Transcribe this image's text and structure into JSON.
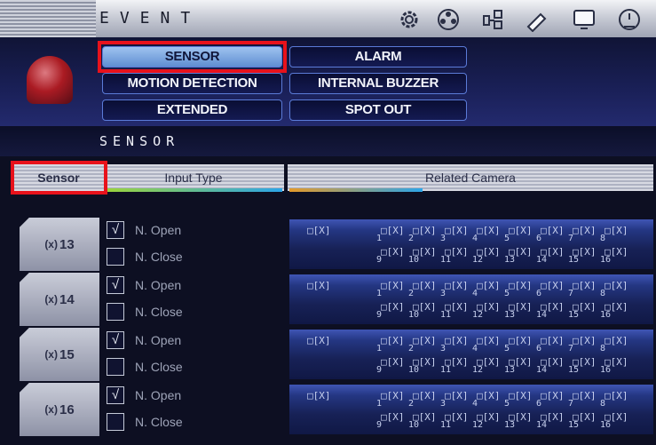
{
  "topbar": {
    "title": "EVENT",
    "icons": [
      "gear-icon",
      "camera-reel-icon",
      "network-icon",
      "pen-icon",
      "monitor-icon",
      "shutdown-icon"
    ]
  },
  "menu": {
    "items": [
      {
        "label": "SENSOR",
        "active": true
      },
      {
        "label": "ALARM"
      },
      {
        "label": "MOTION DETECTION"
      },
      {
        "label": "INTERNAL BUZZER"
      },
      {
        "label": "EXTENDED"
      },
      {
        "label": "SPOT OUT"
      }
    ]
  },
  "section": {
    "title": "SENSOR"
  },
  "columns": {
    "sensor": "Sensor",
    "input_type": "Input Type",
    "related_camera": "Related Camera"
  },
  "options": {
    "open": "N. Open",
    "close": "N. Close",
    "checked_mark": "√"
  },
  "camera_box": "□[X]",
  "rows": [
    {
      "sensor": "13"
    },
    {
      "sensor": "14"
    },
    {
      "sensor": "15"
    },
    {
      "sensor": "16"
    }
  ],
  "cameras": [
    "1",
    "2",
    "3",
    "4",
    "5",
    "6",
    "7",
    "8",
    "9",
    "10",
    "11",
    "12",
    "13",
    "14",
    "15",
    "16"
  ],
  "colors": {
    "highlight": "#e8121b",
    "active_button": "#7aa7e0",
    "header_bg": "#1a2058"
  }
}
